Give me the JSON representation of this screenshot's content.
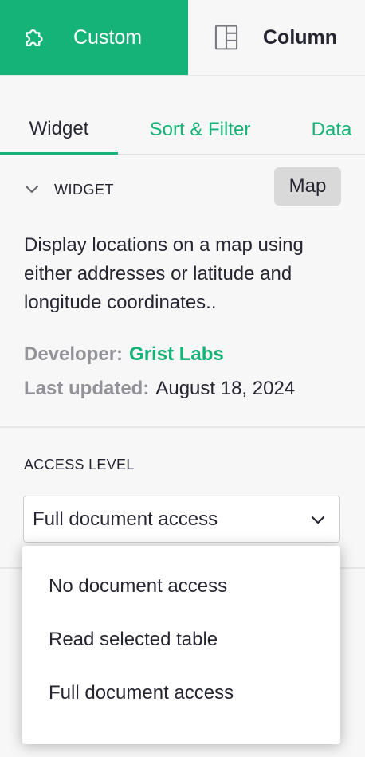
{
  "top_tabs": [
    {
      "label": "Custom",
      "icon": "puzzle-piece-icon",
      "active": true
    },
    {
      "label": "Column",
      "icon": "column-layout-icon",
      "active": false
    }
  ],
  "sub_tabs": [
    {
      "label": "Widget",
      "active": true
    },
    {
      "label": "Sort & Filter",
      "active": false
    },
    {
      "label": "Data",
      "active": false
    }
  ],
  "widget_section": {
    "title": "WIDGET",
    "chevron_icon": "chevron-down-icon",
    "widget_button_label": "Map",
    "description": "Display locations on a map using either addresses or latitude and longitude coordinates..",
    "developer_label": "Developer:",
    "developer_value": "Grist Labs",
    "updated_label": "Last updated:",
    "updated_value": "August 18, 2024"
  },
  "access": {
    "title": "ACCESS LEVEL",
    "selected": "Full document access",
    "options": [
      "No document access",
      "Read selected table",
      "Full document access"
    ]
  },
  "colors": {
    "accent": "#16b378",
    "text": "#262633",
    "muted": "#929299",
    "panel_bg": "#f7f7f7"
  }
}
